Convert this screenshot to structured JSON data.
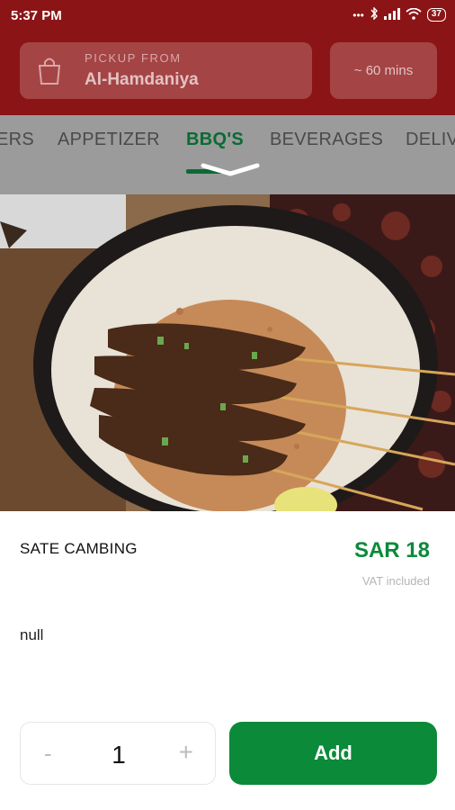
{
  "status_bar": {
    "time": "5:37 PM",
    "battery": "37"
  },
  "header": {
    "pickup_label": "PICKUP FROM",
    "pickup_branch": "Al-Hamdaniya",
    "delivery_time": "~ 60 mins",
    "icon": "shopping-bag-icon"
  },
  "tabs": [
    {
      "label": "ERS"
    },
    {
      "label": "APPETIZER"
    },
    {
      "label": "BBQ'S",
      "active": true
    },
    {
      "label": "BEVERAGES"
    },
    {
      "label": "DELIV"
    }
  ],
  "item": {
    "name": "SATE CAMBING",
    "price": "SAR 18",
    "vat_note": "VAT included",
    "description": "null"
  },
  "quantity": {
    "minus_label": "-",
    "value": "1",
    "plus_label": "+"
  },
  "add_label": "Add",
  "colors": {
    "header_bg": "#8b1516",
    "accent_green": "#0b8a3a",
    "tab_active": "#0b6b34"
  }
}
